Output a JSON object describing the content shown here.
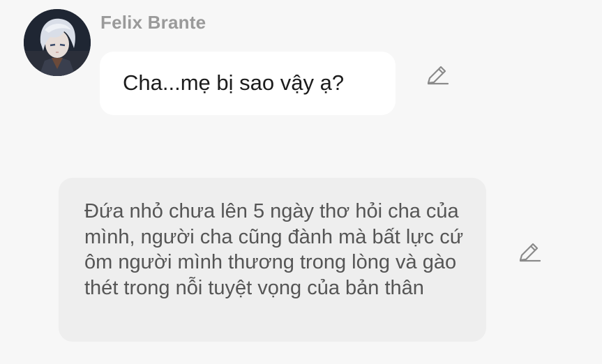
{
  "messages": [
    {
      "kind": "character",
      "sender": "Felix Brante",
      "avatar_icon": "anime-character-avatar",
      "text": "Cha...mẹ bị sao vậy ạ?",
      "edit_icon": "pencil-edit-icon"
    },
    {
      "kind": "narration",
      "text": "Đứa nhỏ chưa lên 5 ngày thơ hỏi cha của mình, người cha cũng đành mà bất lực cứ ôm người mình thương trong lòng và gào thét trong nỗi tuyệt vọng của bản thân",
      "edit_icon": "pencil-edit-icon"
    }
  ],
  "colors": {
    "background": "#f7f7f7",
    "character_bubble": "#ffffff",
    "narration_bubble": "#eeeeee",
    "sender_name": "#9a9a9a",
    "icon": "#8a8a8a"
  }
}
